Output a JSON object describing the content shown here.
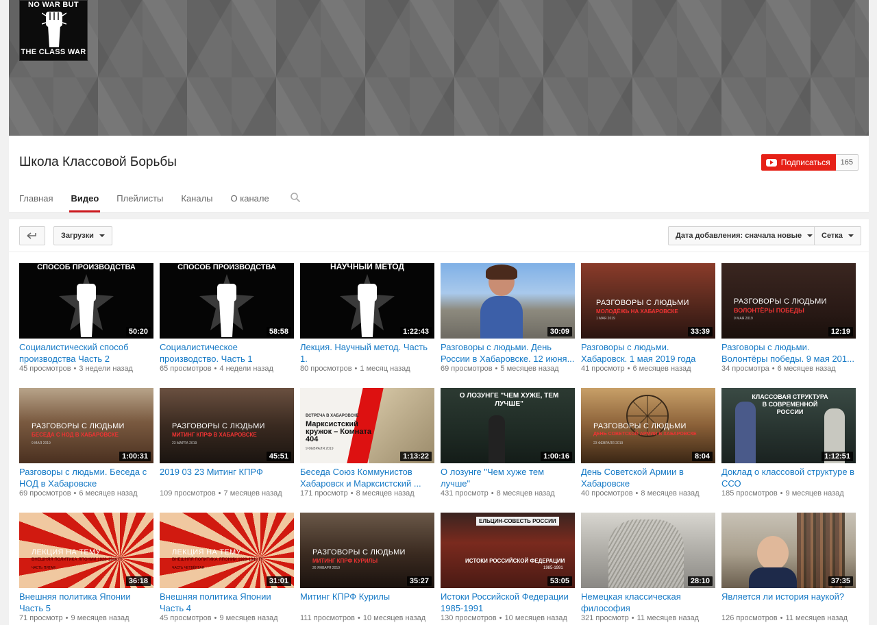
{
  "banner": {
    "avatar_line1": "NO WAR BUT",
    "avatar_line2": "THE CLASS WAR"
  },
  "channel": {
    "title": "Школа Классовой Борьбы",
    "subscribe_label": "Подписаться",
    "subscriber_count": "165",
    "accent": "#e62117"
  },
  "tabs": [
    {
      "label": "Главная"
    },
    {
      "label": "Видео"
    },
    {
      "label": "Плейлисты"
    },
    {
      "label": "Каналы"
    },
    {
      "label": "О канале"
    }
  ],
  "toolbar": {
    "uploads_label": "Загрузки",
    "sort_label": "Дата добавления: сначала новые",
    "view_label": "Сетка"
  },
  "videos": [
    {
      "title": "Социалистический способ производства Часть 2",
      "views": "45 просмотров",
      "age": "3 недели назад",
      "duration": "50:20",
      "thumb_text": "СПОСОБ ПРОИЗВОДСТВА"
    },
    {
      "title": "Социалистическое производство. Часть 1",
      "views": "65 просмотров",
      "age": "4 недели назад",
      "duration": "58:58",
      "thumb_text": "СПОСОБ ПРОИЗВОДСТВА"
    },
    {
      "title": "Лекция. Научный метод. Часть 1.",
      "views": "80 просмотров",
      "age": "1 месяц назад",
      "duration": "1:22:43",
      "thumb_text": "НАУЧНЫЙ МЕТОД"
    },
    {
      "title": "Разговоры с людьми. День России в Хабаровске. 12 июня...",
      "views": "69 просмотров",
      "age": "5 месяцев назад",
      "duration": "30:09",
      "thumb_text": ""
    },
    {
      "title": "Разговоры с людьми. Хабаровск. 1 мая 2019 года",
      "views": "41 просмотр",
      "age": "6 месяцев назад",
      "duration": "33:39",
      "thumb_text": "РАЗГОВОРЫ С ЛЮДЬМИ",
      "thumb_sub": "МОЛОДЁЖЬ НА ХАБАРОВСКЕ",
      "thumb_date": "1 МАЯ 2019"
    },
    {
      "title": "Разговоры с людьми. Волонтёры победы. 9 мая 201...",
      "views": "34 просмотра",
      "age": "6 месяцев назад",
      "duration": "12:19",
      "thumb_text": "РАЗГОВОРЫ С ЛЮДЬМИ",
      "thumb_sub": "ВОЛОНТЁРЫ ПОБЕДЫ",
      "thumb_date": "9 МАЯ 2019"
    },
    {
      "title": "Разговоры с людьми. Беседа с НОД в Хабаровске",
      "views": "69 просмотров",
      "age": "6 месяцев назад",
      "duration": "1:00:31",
      "thumb_text": "РАЗГОВОРЫ С ЛЮДЬМИ",
      "thumb_sub": "БЕСЕДА С НОД В ХАБАРОВСКЕ",
      "thumb_date": "9 МАЯ 2019"
    },
    {
      "title": "2019 03 23 Митинг КПРФ",
      "views": "109 просмотров",
      "age": "7 месяцев назад",
      "duration": "45:51",
      "thumb_text": "РАЗГОВОРЫ С ЛЮДЬМИ",
      "thumb_sub": "МИТИНГ КПРФ В ХАБАРОВСКЕ",
      "thumb_date": "23 МАРТА 2019"
    },
    {
      "title": "Беседа Союз Коммунистов Хабаровск и Марксистский ...",
      "views": "171 просмотр",
      "age": "8 месяцев назад",
      "duration": "1:13:22",
      "thumb_text": "Марксистский кружок – Комната 404",
      "thumb_sub": "ВСТРЕЧА В ХАБАРОВСКЕ",
      "thumb_date": "9 ФЕВРАЛЯ 2019"
    },
    {
      "title": "О лозунге \"Чем хуже тем лучше\"",
      "views": "431 просмотр",
      "age": "8 месяцев назад",
      "duration": "1:00:16",
      "thumb_text": "О ЛОЗУНГЕ \"ЧЕМ ХУЖЕ, ТЕМ ЛУЧШЕ\""
    },
    {
      "title": "День Советской Армии в Хабаровске",
      "views": "40 просмотров",
      "age": "8 месяцев назад",
      "duration": "8:04",
      "thumb_text": "РАЗГОВОРЫ С ЛЮДЬМИ",
      "thumb_sub": "ДЕНЬ СОВЕТСКОЙ АРМИИ В ХАБАРОВСКЕ",
      "thumb_date": "23 ФЕВРАЛЯ 2019"
    },
    {
      "title": "Доклад о классовой структуре в ССО",
      "views": "185 просмотров",
      "age": "9 месяцев назад",
      "duration": "1:12:51",
      "thumb_text": "КЛАССОВАЯ СТРУКТУРА В СОВРЕМЕННОЙ РОССИИ"
    },
    {
      "title": "Внешняя политика Японии Часть 5",
      "views": "71 просмотр",
      "age": "9 месяцев назад",
      "duration": "36:18",
      "thumb_text": "ЛЕКЦИЯ НА ТЕМУ",
      "thumb_sub": "ВНЕШНЯЯ ПОЛИТИКА ЯПОНИИ 1920-1940 ГГ",
      "thumb_date": "ЧАСТЬ ПЯТАЯ"
    },
    {
      "title": "Внешняя политика Японии Часть 4",
      "views": "45 просмотров",
      "age": "9 месяцев назад",
      "duration": "31:01",
      "thumb_text": "ЛЕКЦИЯ НА ТЕМУ",
      "thumb_sub": "ВНЕШНЯЯ ПОЛИТИКА ЯПОНИИ 1920-1940 ГГ",
      "thumb_date": "ЧАСТЬ ЧЕТВЁРТАЯ"
    },
    {
      "title": "Митинг КПРФ Курилы",
      "views": "111 просмотров",
      "age": "10 месяцев назад",
      "duration": "35:27",
      "thumb_text": "РАЗГОВОРЫ С ЛЮДЬМИ",
      "thumb_sub": "МИТИНГ КПРФ КУРИЛЫ",
      "thumb_date": "26 ЯНВАРЯ 2019"
    },
    {
      "title": "Истоки Российской Федерации 1985-1991",
      "views": "130 просмотров",
      "age": "10 месяцев назад",
      "duration": "53:05",
      "thumb_text": "ИСТОКИ РОССИЙСКОЙ ФЕДЕРАЦИИ",
      "thumb_sub": "ЕЛЬЦИН-СОВЕСТЬ РОССИИ",
      "thumb_date": "1985-1991"
    },
    {
      "title": "Немецкая классическая философия",
      "views": "321 просмотр",
      "age": "11 месяцев назад",
      "duration": "28:10",
      "thumb_text": ""
    },
    {
      "title": "Является ли история наукой?",
      "views": "126 просмотров",
      "age": "11 месяцев назад",
      "duration": "37:35",
      "thumb_text": ""
    }
  ]
}
